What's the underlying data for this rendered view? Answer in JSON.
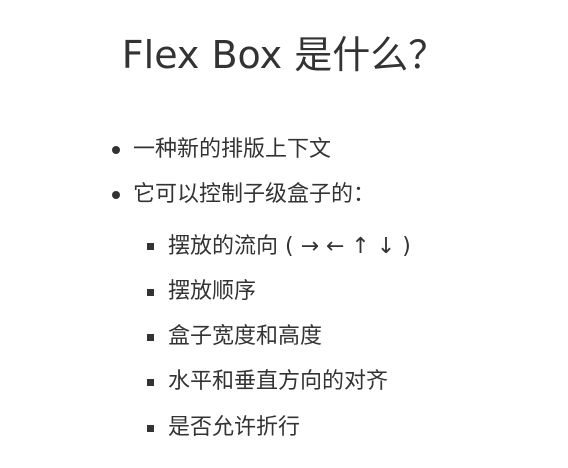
{
  "slide": {
    "title": "Flex Box 是什么？",
    "bullets": [
      "一种新的排版上下文",
      "它可以控制子级盒子的："
    ],
    "sub_bullets": [
      "摆放的流向 ( → ← ↑ ↓ )",
      "摆放顺序",
      "盒子宽度和高度",
      "水平和垂直方向的对齐",
      "是否允许折行"
    ]
  },
  "colors": {
    "text": "#333333",
    "background": "#ffffff"
  }
}
